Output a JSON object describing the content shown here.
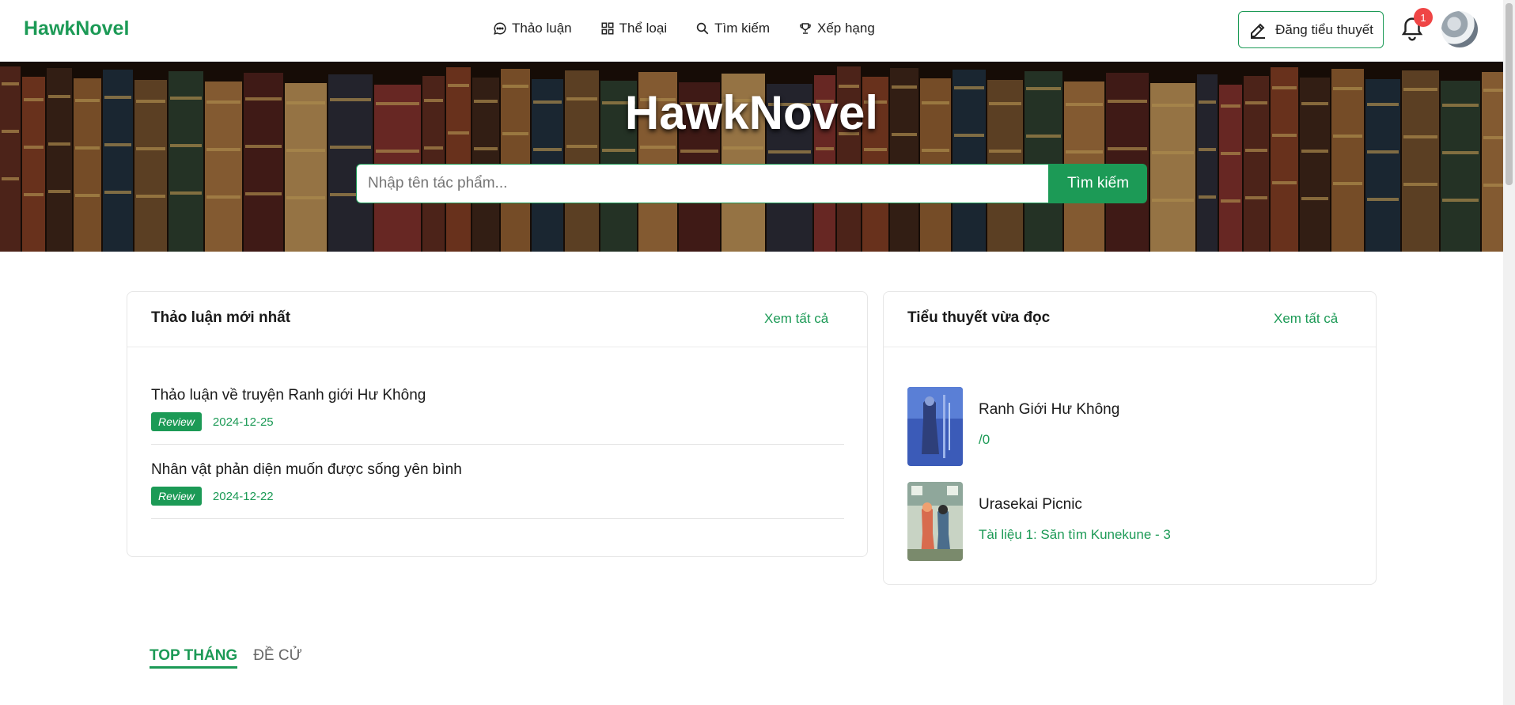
{
  "brand": "HawkNovel",
  "nav": {
    "items": [
      {
        "label": "Thảo luận",
        "icon": "chat-bubble-icon"
      },
      {
        "label": "Thể loại",
        "icon": "grid-icon"
      },
      {
        "label": "Tìm kiếm",
        "icon": "search-icon"
      },
      {
        "label": "Xếp hạng",
        "icon": "trophy-icon"
      }
    ]
  },
  "header": {
    "post_label": "Đăng tiểu thuyết",
    "notification_count": "1"
  },
  "hero": {
    "title": "HawkNovel",
    "search_placeholder": "Nhập tên tác phẩm...",
    "search_button": "Tìm kiếm"
  },
  "discussions": {
    "title": "Thảo luận mới nhất",
    "view_all": "Xem tất cả",
    "items": [
      {
        "title": "Thảo luận về truyện Ranh giới Hư Không",
        "tag": "Review",
        "date": "2024-12-25"
      },
      {
        "title": "Nhân vật phản diện muốn được sống yên bình",
        "tag": "Review",
        "date": "2024-12-22"
      }
    ]
  },
  "recent": {
    "title": "Tiểu thuyết vừa đọc",
    "view_all": "Xem tất cả",
    "items": [
      {
        "name": "Ranh Giới Hư Không",
        "chapter": "/0"
      },
      {
        "name": "Urasekai Picnic",
        "chapter": "Tài liệu 1: Săn tìm Kunekune - 3"
      }
    ]
  },
  "tabs": {
    "top_month": "TOP THÁNG",
    "recommended": "ĐỀ CỬ"
  },
  "colors": {
    "accent": "#1c9a56",
    "badge": "#ef4545"
  }
}
